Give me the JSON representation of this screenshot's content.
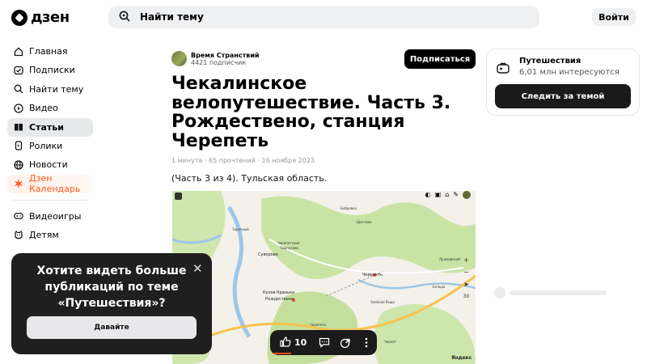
{
  "header": {
    "logo_text": "дзен",
    "search_placeholder": "Найти тему",
    "login_label": "Войти"
  },
  "sidebar": {
    "items": [
      {
        "label": "Главная",
        "icon": "home-icon"
      },
      {
        "label": "Подписки",
        "icon": "subscriptions-icon"
      },
      {
        "label": "Найти тему",
        "icon": "search-topic-icon"
      },
      {
        "label": "Видео",
        "icon": "video-icon"
      },
      {
        "label": "Статьи",
        "icon": "articles-icon",
        "active": true
      },
      {
        "label": "Ролики",
        "icon": "shorts-icon"
      },
      {
        "label": "Новости",
        "icon": "news-icon"
      },
      {
        "label": "Дзен Календарь",
        "icon": "calendar-burst-icon"
      }
    ],
    "secondary_items": [
      {
        "label": "Видеоигры",
        "icon": "gamepad-icon"
      },
      {
        "label": "Детям",
        "icon": "kids-icon"
      }
    ]
  },
  "article": {
    "author_name": "Время Странствий",
    "author_subscribers": "4421 подписчик",
    "subscribe_label": "Подписаться",
    "title": "Чекалинское велопутешествие. Часть 3. Рождествено, станция Черепеть",
    "meta": "1 минута · 65 прочтений · 16 ноября 2023",
    "lead": "(Часть 3 из 4). Тульская область."
  },
  "map": {
    "labels": [
      "Бобровка",
      "Щеглово",
      "Черепетский",
      "Тюрнуково",
      "Суворово",
      "Черепеть",
      "Кухов Кранька",
      "Рождествено",
      "Заречный",
      "Лужковский",
      "Зелёная Роща",
      "Черепеть",
      "Бельда",
      "Черхет"
    ],
    "zoom_level": "30",
    "attribution": "Яндекс"
  },
  "topic": {
    "name": "Путешествия",
    "followers": "6,01 млн интересуются",
    "follow_label": "Следить за темой"
  },
  "popup": {
    "text": "Хотите видеть больше публикаций по теме «Путешествия»?",
    "button_label": "Давайте",
    "close_symbol": "✕"
  },
  "actions": {
    "like_count": "10"
  },
  "colors": {
    "accent": "#ff5a1f",
    "dark": "#1b1b1b",
    "map_green": "#c9e3a4",
    "map_water": "#9cc7e8"
  }
}
